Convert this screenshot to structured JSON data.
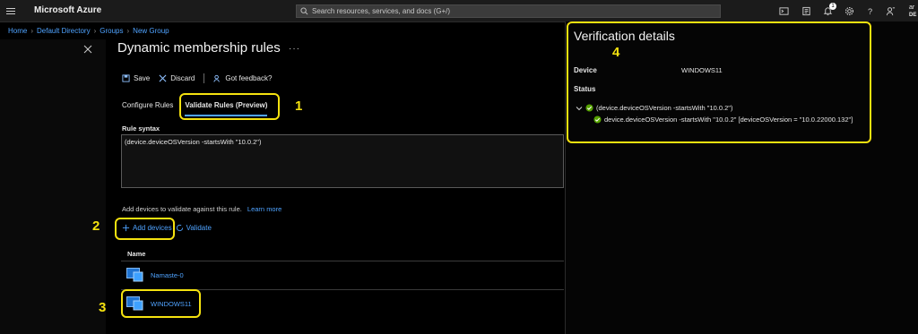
{
  "app": {
    "title": "Microsoft Azure"
  },
  "search": {
    "placeholder": "Search resources, services, and docs (G+/)"
  },
  "topbar": {
    "icons": [
      "cloud-shell-icon",
      "directory-filter-icon",
      "notifications-icon",
      "settings-icon",
      "help-icon",
      "feedback-icon"
    ],
    "notification_count": "1",
    "user_line1": "ar",
    "user_line2": "DE"
  },
  "breadcrumb": [
    "Home",
    "Default Directory",
    "Groups",
    "New Group"
  ],
  "blade": {
    "title": "Dynamic membership rules",
    "more": "···",
    "commands": {
      "save": "Save",
      "discard": "Discard",
      "feedback": "Got feedback?"
    },
    "tabs": [
      "Configure Rules",
      "Validate Rules (Preview)"
    ],
    "active_tab": 1,
    "rule_syntax_label": "Rule syntax",
    "rule_syntax_value": "(device.deviceOSVersion -startsWith \"10.0.2\")",
    "add_devices_text": "Add devices to validate against this rule.",
    "learn_more": "Learn more",
    "add_devices_label": "Add devices",
    "validate_label": "Validate",
    "table_header": "Name",
    "devices": [
      "Namaste-0",
      "WINDOWS11"
    ]
  },
  "verification": {
    "title": "Verification details",
    "device_label": "Device",
    "device_value": "WINDOWS11",
    "status_label": "Status",
    "rule_expr": "(device.deviceOSVersion -startsWith \"10.0.2\")",
    "rule_detail": "device.deviceOSVersion -startsWith \"10.0.2\" [deviceOSVersion = \"10.0.22000.132\"]"
  },
  "annotations": [
    "1",
    "2",
    "3",
    "4"
  ],
  "colors": {
    "accent": "#4fa3ff",
    "annotation": "#f5e20f",
    "success": "#57a300"
  }
}
